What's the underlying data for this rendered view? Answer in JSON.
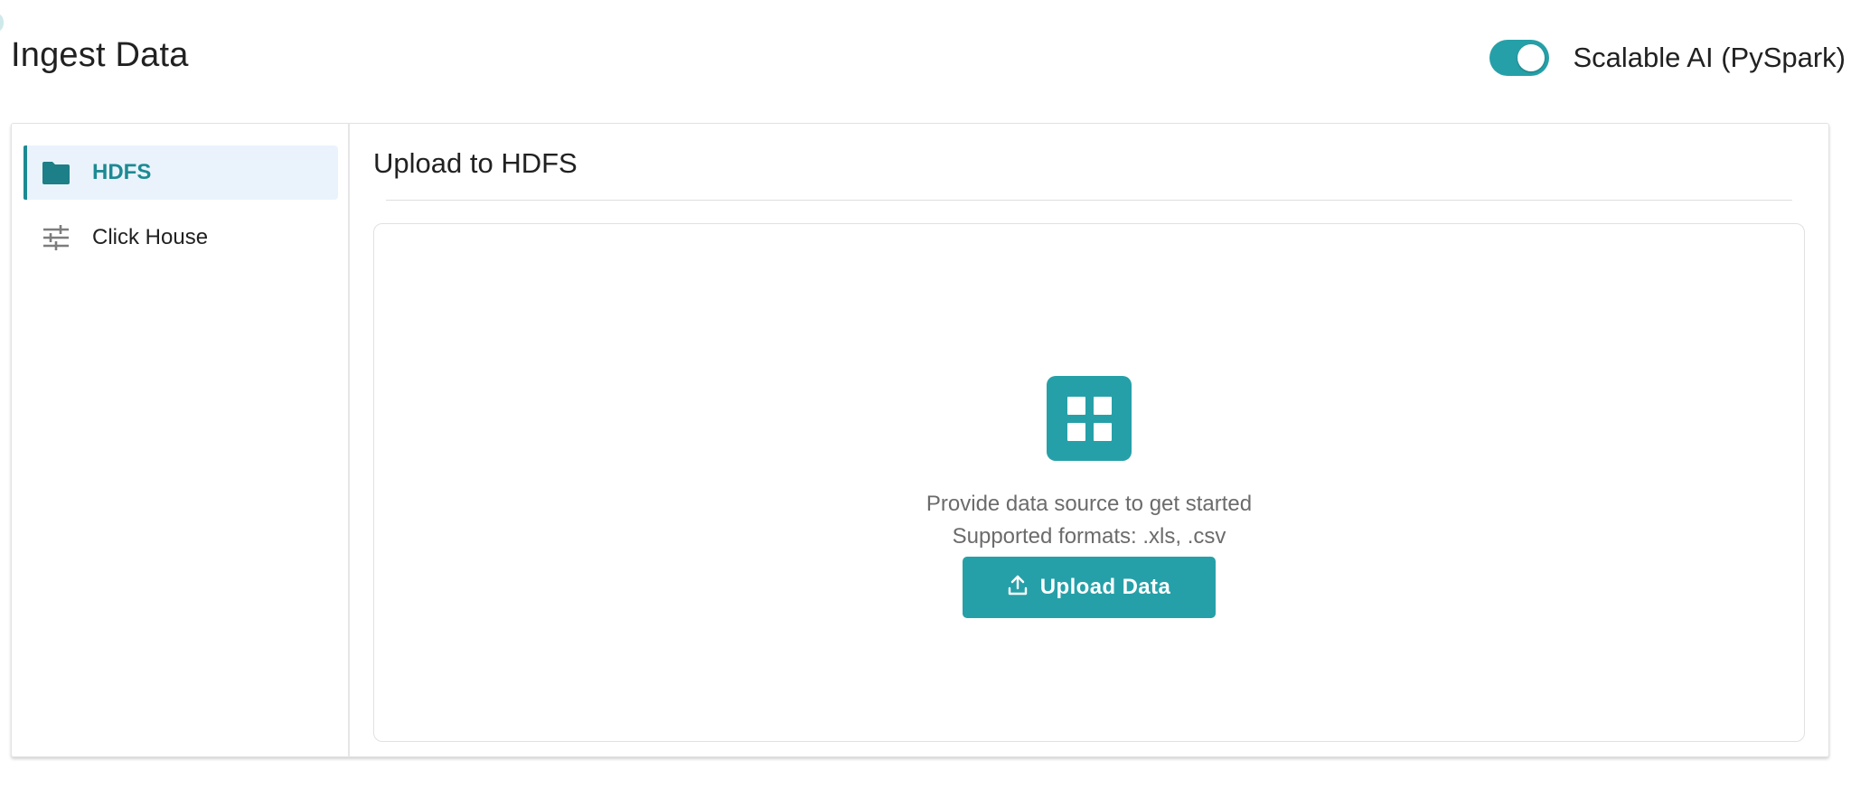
{
  "header": {
    "title": "Ingest Data",
    "toggle": {
      "label": "Scalable AI (PySpark)",
      "checked": true,
      "color": "#26a0a8"
    }
  },
  "sidebar": {
    "items": [
      {
        "label": "HDFS",
        "icon": "folder-icon",
        "active": true
      },
      {
        "label": "Click House",
        "icon": "sliders-icon",
        "active": false
      }
    ]
  },
  "main": {
    "title": "Upload to HDFS",
    "dropzone": {
      "icon": "grid-icon",
      "prompt": "Provide data source to get started",
      "formats": "Supported formats: .xls, .csv",
      "button_label": "Upload Data",
      "button_icon": "upload-icon"
    }
  },
  "colors": {
    "accent": "#26a0a8",
    "accent_dark": "#1d8a93",
    "active_bg": "#eaf3fc"
  }
}
